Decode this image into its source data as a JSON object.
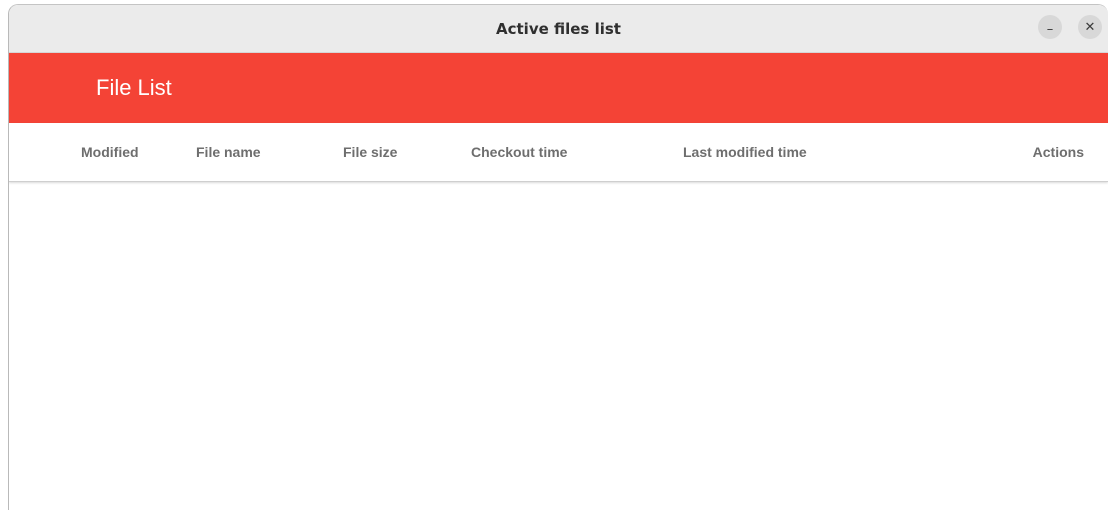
{
  "window": {
    "title": "Active files list",
    "minimize_glyph": "–",
    "close_glyph": "✕"
  },
  "appbar": {
    "title": "File List",
    "accent_color": "#f44336"
  },
  "table": {
    "columns": [
      "Modified",
      "File name",
      "File size",
      "Checkout time",
      "Last modified time",
      "Actions"
    ],
    "rows": []
  }
}
